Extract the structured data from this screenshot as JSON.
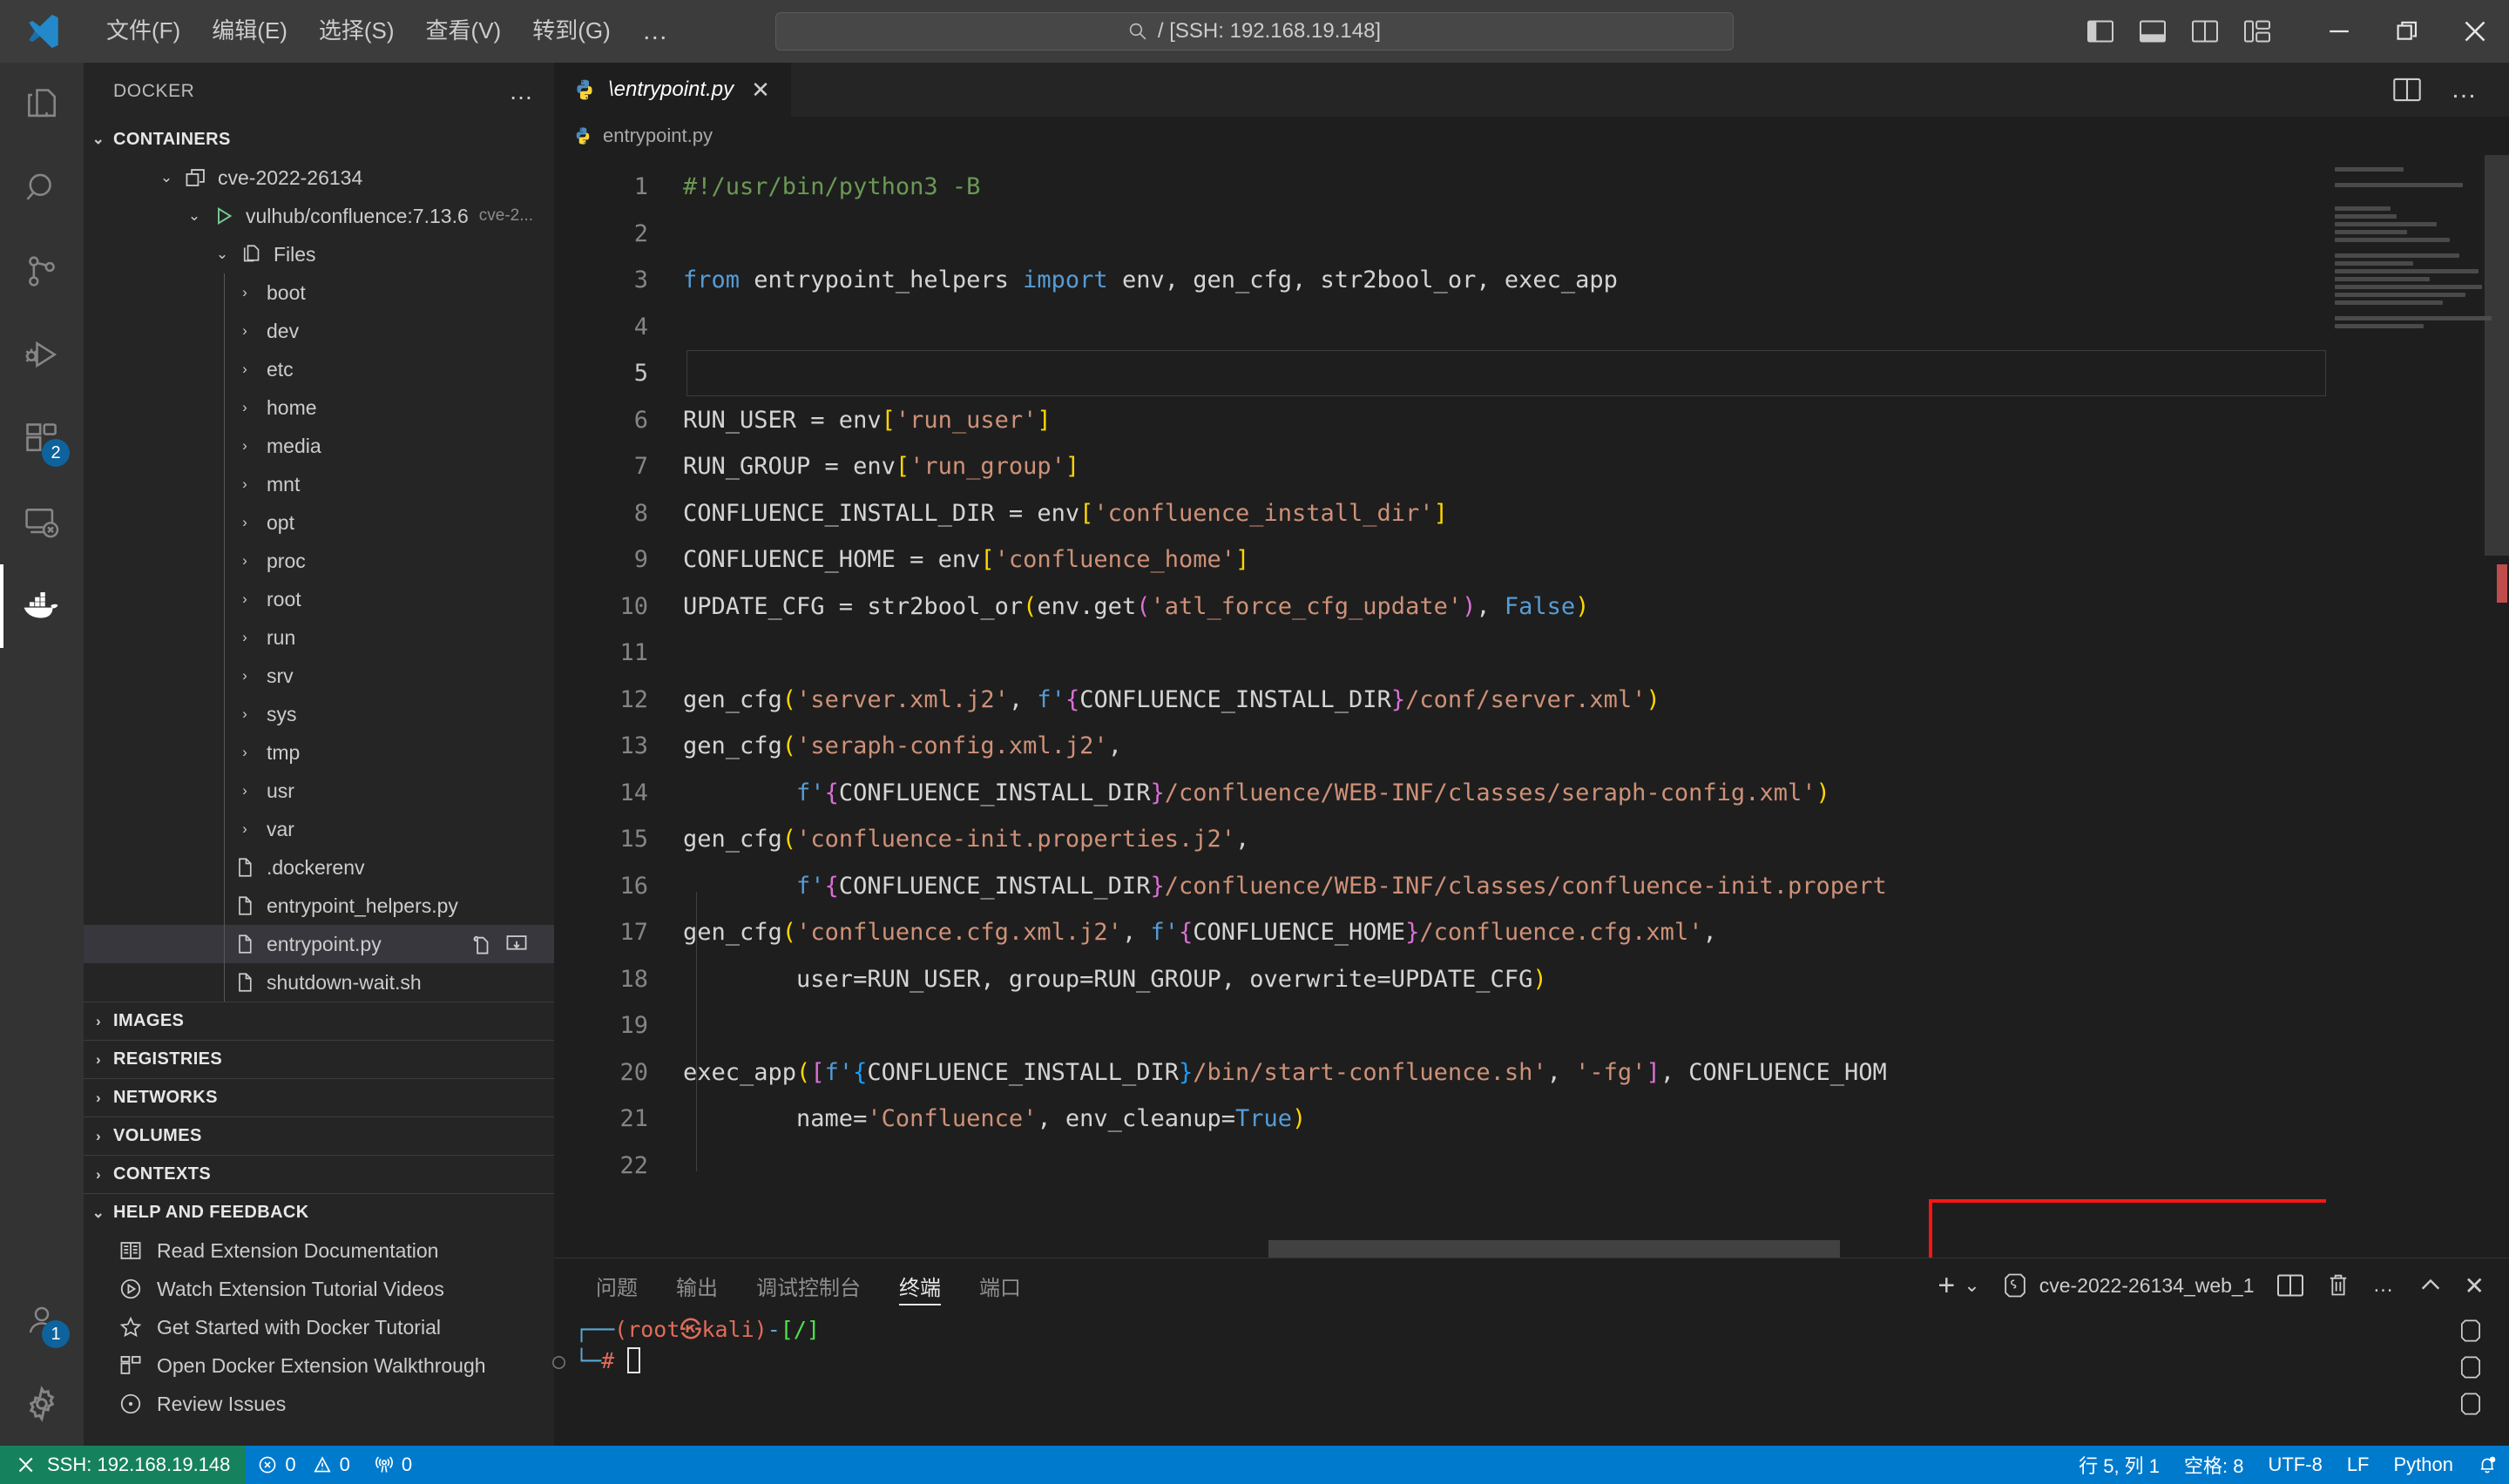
{
  "titlebar": {
    "menu": [
      "文件(F)",
      "编辑(E)",
      "选择(S)",
      "查看(V)",
      "转到(G)"
    ],
    "more": "…",
    "back_icon": "arrow-left-icon",
    "forward_icon": "arrow-right-icon",
    "command_center": "/ [SSH: 192.168.19.148]",
    "layout_icons": [
      "toggle-primary-sidebar-icon",
      "toggle-panel-icon",
      "toggle-secondary-sidebar-icon",
      "customize-layout-icon"
    ],
    "window_controls": [
      "minimize",
      "restore",
      "close"
    ]
  },
  "activitybar": {
    "items": [
      {
        "name": "explorer",
        "badge": ""
      },
      {
        "name": "search",
        "badge": ""
      },
      {
        "name": "source-control",
        "badge": ""
      },
      {
        "name": "run-and-debug",
        "badge": ""
      },
      {
        "name": "extensions",
        "badge": "2"
      },
      {
        "name": "remote-explorer",
        "badge": ""
      },
      {
        "name": "docker",
        "badge": ""
      }
    ],
    "accounts_badge": "1",
    "settings": "manage-gear"
  },
  "sidebar": {
    "title": "DOCKER",
    "more": "…",
    "sections": [
      {
        "label": "CONTAINERS",
        "expanded": true
      },
      {
        "label": "IMAGES",
        "expanded": false
      },
      {
        "label": "REGISTRIES",
        "expanded": false
      },
      {
        "label": "NETWORKS",
        "expanded": false
      },
      {
        "label": "VOLUMES",
        "expanded": false
      },
      {
        "label": "CONTEXTS",
        "expanded": false
      },
      {
        "label": "HELP AND FEEDBACK",
        "expanded": true
      }
    ],
    "container": {
      "label": "cve-2022-26134"
    },
    "image": {
      "label": "vulhub/confluence:7.13.6",
      "sublabel": "cve-2..."
    },
    "files_node": "Files",
    "folders": [
      "boot",
      "dev",
      "etc",
      "home",
      "media",
      "mnt",
      "opt",
      "proc",
      "root",
      "run",
      "srv",
      "sys",
      "tmp",
      "usr",
      "var"
    ],
    "files": [
      ".dockerenv",
      "entrypoint_helpers.py",
      "entrypoint.py",
      "shutdown-wait.sh"
    ],
    "selected_file": "entrypoint.py",
    "row_action_icons": [
      "open-file-icon",
      "download-file-icon"
    ],
    "help_items": [
      {
        "label": "Read Extension Documentation",
        "icon": "book-icon"
      },
      {
        "label": "Watch Extension Tutorial Videos",
        "icon": "play-circle-icon"
      },
      {
        "label": "Get Started with Docker Tutorial",
        "icon": "star-icon"
      },
      {
        "label": "Open Docker Extension Walkthrough",
        "icon": "layout-icon"
      },
      {
        "label": "Review Issues",
        "icon": "issues-icon"
      }
    ]
  },
  "editor": {
    "tab": {
      "label": "\\entrypoint.py",
      "icon": "python-icon",
      "close": "✕"
    },
    "tab_actions": [
      "split-editor-icon",
      "more-actions-icon"
    ],
    "breadcrumb": "entrypoint.py",
    "current_line": 5,
    "lines": [
      {
        "n": "1",
        "html": "<span class='com'>#!/usr/bin/python3 -B</span>"
      },
      {
        "n": "2",
        "html": ""
      },
      {
        "n": "3",
        "html": "<span class='kw'>from</span> entrypoint_helpers <span class='kw'>import</span> env, gen_cfg, str2bool_or, exec_app"
      },
      {
        "n": "4",
        "html": ""
      },
      {
        "n": "5",
        "html": ""
      },
      {
        "n": "6",
        "html": "RUN_USER = env<span class='br-y'>[</span><span class='str'>'run_user'</span><span class='br-y'>]</span>"
      },
      {
        "n": "7",
        "html": "RUN_GROUP = env<span class='br-y'>[</span><span class='str'>'run_group'</span><span class='br-y'>]</span>"
      },
      {
        "n": "8",
        "html": "CONFLUENCE_INSTALL_DIR = env<span class='br-y'>[</span><span class='str'>'confluence_install_dir'</span><span class='br-y'>]</span>"
      },
      {
        "n": "9",
        "html": "CONFLUENCE_HOME = env<span class='br-y'>[</span><span class='str'>'confluence_home'</span><span class='br-y'>]</span>"
      },
      {
        "n": "10",
        "html": "UPDATE_CFG = str2bool_or<span class='br-y'>(</span>env.get<span class='br-p'>(</span><span class='str'>'atl_force_cfg_update'</span><span class='br-p'>)</span>, <span class='kw'>False</span><span class='br-y'>)</span>"
      },
      {
        "n": "11",
        "html": ""
      },
      {
        "n": "12",
        "html": "gen_cfg<span class='br-y'>(</span><span class='str'>'server.xml.j2'</span>, <span class='fpre'>f'</span><span class='br-p'>{</span>CONFLUENCE_INSTALL_DIR<span class='br-p'>}</span><span class='str'>/conf/server.xml'</span><span class='br-y'>)</span>"
      },
      {
        "n": "13",
        "html": "gen_cfg<span class='br-y'>(</span><span class='str'>'seraph-config.xml.j2'</span>,"
      },
      {
        "n": "14",
        "html": "        <span class='fpre'>f'</span><span class='br-p'>{</span>CONFLUENCE_INSTALL_DIR<span class='br-p'>}</span><span class='str'>/confluence/WEB-INF/classes/seraph-config.xml'</span><span class='br-y'>)</span>"
      },
      {
        "n": "15",
        "html": "gen_cfg<span class='br-y'>(</span><span class='str'>'confluence-init.properties.j2'</span>,"
      },
      {
        "n": "16",
        "html": "        <span class='fpre'>f'</span><span class='br-p'>{</span>CONFLUENCE_INSTALL_DIR<span class='br-p'>}</span><span class='str'>/confluence/WEB-INF/classes/confluence-init.propert</span>"
      },
      {
        "n": "17",
        "html": "gen_cfg<span class='br-y'>(</span><span class='str'>'confluence.cfg.xml.j2'</span>, <span class='fpre'>f'</span><span class='br-p'>{</span>CONFLUENCE_HOME<span class='br-p'>}</span><span class='str'>/confluence.cfg.xml'</span>,"
      },
      {
        "n": "18",
        "html": "        user=RUN_USER, group=RUN_GROUP, overwrite=UPDATE_CFG<span class='br-y'>)</span>"
      },
      {
        "n": "19",
        "html": ""
      },
      {
        "n": "20",
        "html": "exec_app<span class='br-y'>(</span><span class='br-p'>[</span><span class='fpre'>f'</span><span class='br-b'>{</span>CONFLUENCE_INSTALL_DIR<span class='br-b'>}</span><span class='str'>/bin/start-confluence.sh'</span>, <span class='str'>'-fg'</span><span class='br-p'>]</span>, CONFLUENCE_HOM"
      },
      {
        "n": "21",
        "html": "        name=<span class='str'>'Confluence'</span>, env_cleanup=<span class='kw'>True</span><span class='br-y'>)</span>"
      },
      {
        "n": "22",
        "html": ""
      }
    ],
    "annotation": {
      "type": "red-rectangle",
      "color": "#fb1515",
      "target": "/bin/start-confluence.sh'"
    }
  },
  "panel": {
    "tabs": [
      {
        "label": "问题",
        "active": false
      },
      {
        "label": "输出",
        "active": false
      },
      {
        "label": "调试控制台",
        "active": false
      },
      {
        "label": "终端",
        "active": true
      },
      {
        "label": "端口",
        "active": false
      }
    ],
    "actions": {
      "new_terminal": "+",
      "new_terminal_dropdown": "⌄",
      "terminal_name": "cve-2022-26134_web_1",
      "split": "split-terminal-icon",
      "kill": "trash-icon",
      "more": "…",
      "maximize": "chevron-up-icon",
      "close": "✕"
    },
    "terminal": {
      "prompt_line1_prefix": "┌──",
      "prompt_user": "(root",
      "prompt_sym": "㉿",
      "prompt_host": "kali)",
      "prompt_dash": "-",
      "prompt_path": "[/]",
      "prompt_line2_prefix": "└─",
      "prompt_hash": "#",
      "gutter_mark": "○"
    }
  },
  "statusbar": {
    "remote": "SSH: 192.168.19.148",
    "errors": "0",
    "warnings": "0",
    "radio_count": "0",
    "line_col": "行 5, 列 1",
    "indent": "空格: 8",
    "encoding": "UTF-8",
    "eol": "LF",
    "language": "Python",
    "bell": "bell-icon"
  }
}
